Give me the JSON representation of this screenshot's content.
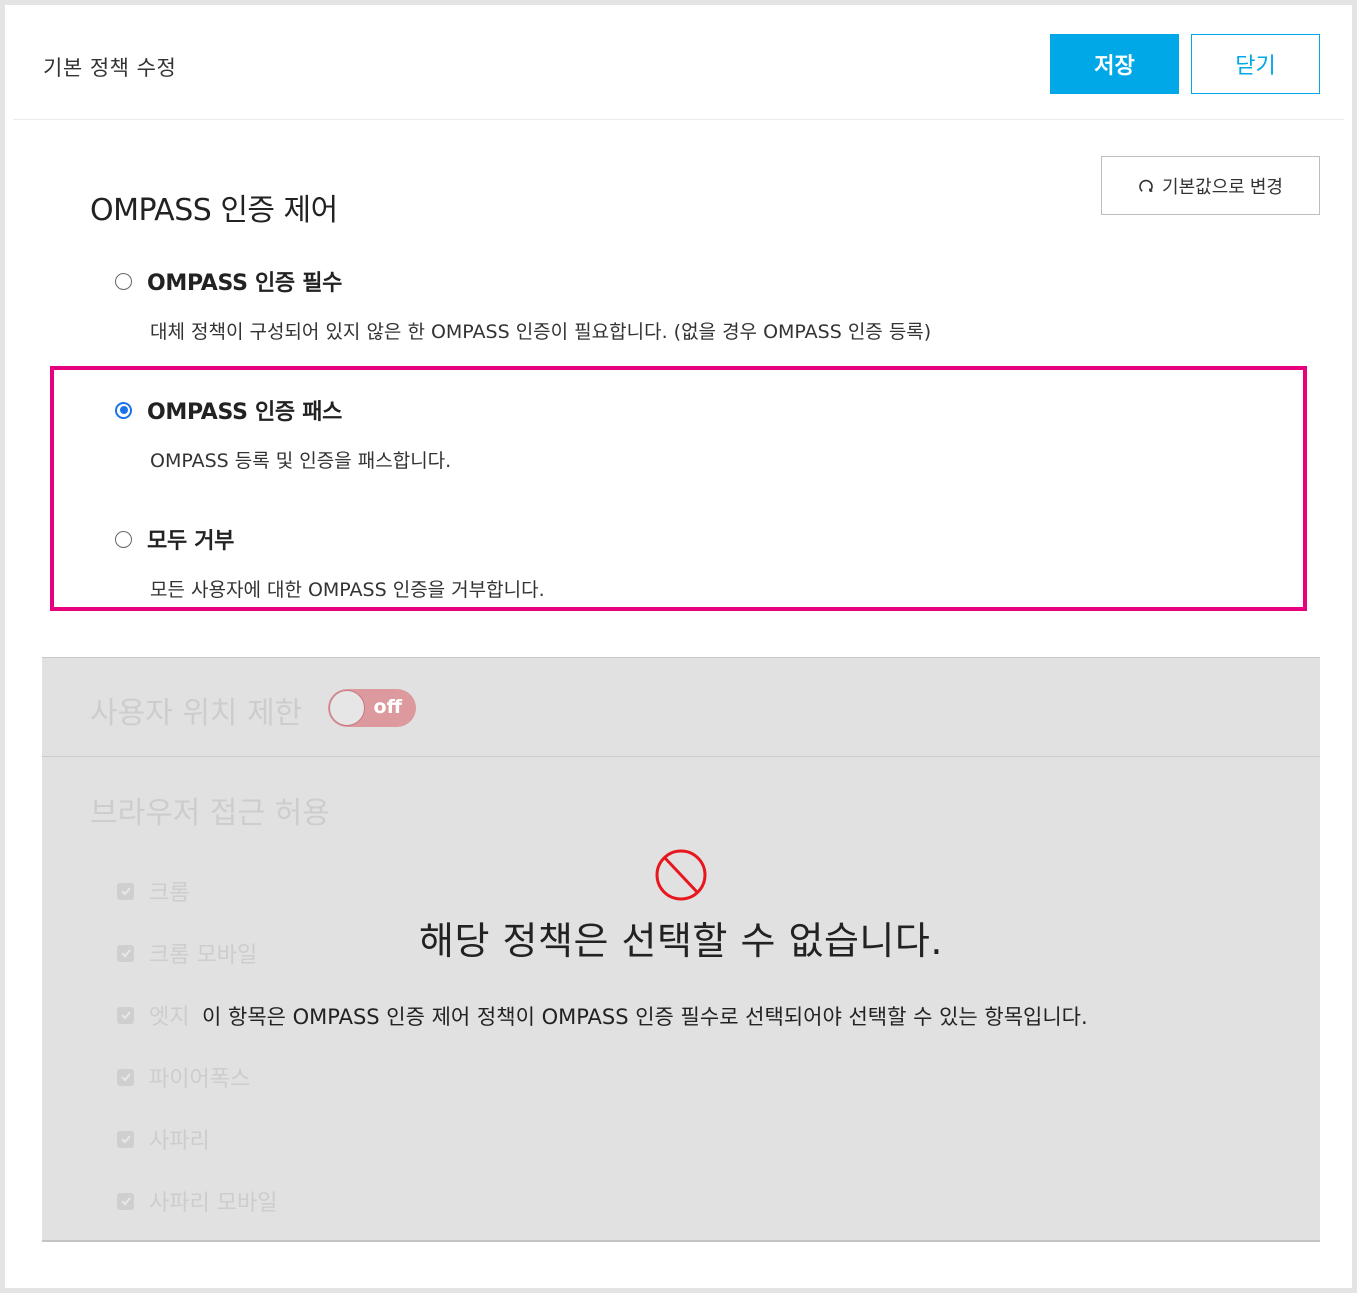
{
  "header": {
    "title": "기본 정책 수정",
    "save_label": "저장",
    "close_label": "닫기"
  },
  "reset_button": {
    "label": "기본값으로 변경",
    "icon": "refresh-icon"
  },
  "auth_control": {
    "title": "OMPASS 인증 제어",
    "selected": "pass",
    "options": [
      {
        "id": "required",
        "label": "OMPASS 인증 필수",
        "description": "대체 정책이 구성되어 있지 않은 한 OMPASS 인증이 필요합니다. (없을 경우 OMPASS 인증 등록)",
        "checked": false
      },
      {
        "id": "pass",
        "label": "OMPASS 인증 패스",
        "description": "OMPASS 등록 및 인증을 패스합니다.",
        "checked": true
      },
      {
        "id": "deny",
        "label": "모두 거부",
        "description": "모든 사용자에 대한 OMPASS 인증을 거부합니다.",
        "checked": false
      }
    ],
    "highlight_color": "#e6007e",
    "radio_color": "#1a73e8"
  },
  "location_restriction": {
    "title": "사용자 위치 제한",
    "toggle_label": "off",
    "toggle_on": false
  },
  "browser_access": {
    "title": "브라우저 접근 허용",
    "items": [
      {
        "label": "크롬",
        "checked": true
      },
      {
        "label": "크롬 모바일",
        "checked": true
      },
      {
        "label": "엣지",
        "checked": true
      },
      {
        "label": "파이어폭스",
        "checked": true
      },
      {
        "label": "사파리",
        "checked": true
      },
      {
        "label": "사파리 모바일",
        "checked": true
      }
    ]
  },
  "disabled_notice": {
    "icon": "prohibited-icon",
    "title": "해당 정책은 선택할 수 없습니다.",
    "description": "이 항목은 OMPASS 인증 제어 정책이 OMPASS 인증 필수로 선택되어야 선택할 수 있는 항목입니다."
  },
  "colors": {
    "primary": "#00a8e8",
    "toggle_off": "#dc9a9e",
    "prohibited": "#e8171e"
  }
}
